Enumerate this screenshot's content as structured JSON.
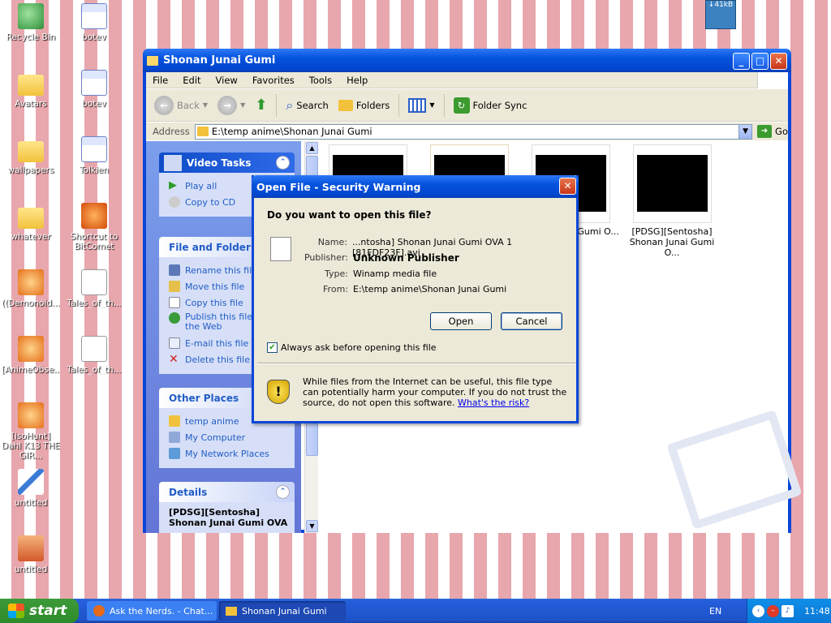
{
  "desktop": {
    "icons": [
      {
        "label": "Recycle Bin",
        "icon": "recycle-bin-icon"
      },
      {
        "label": "botev",
        "icon": "word-document-icon"
      },
      {
        "label": "Avatars",
        "icon": "folder-icon"
      },
      {
        "label": "botev",
        "icon": "word-document-icon"
      },
      {
        "label": "wallpapers",
        "icon": "folder-icon"
      },
      {
        "label": "Tolkien",
        "icon": "word-document-icon"
      },
      {
        "label": "whatever",
        "icon": "folder-icon"
      },
      {
        "label": "Shortcut to BitComet",
        "icon": "bitcomet-icon"
      },
      {
        "label": "((Demonoid....",
        "icon": "winamp-file-icon"
      },
      {
        "label": "Tales_of_th...",
        "icon": "script-file-icon"
      },
      {
        "label": "[AnimeObse...",
        "icon": "winamp-file-icon"
      },
      {
        "label": "Tales_of_th...",
        "icon": "script-file-icon"
      },
      {
        "label": "[isoHunt] Dahl K13 THE GIR...",
        "icon": "winamp-file-icon"
      },
      {
        "label": "untitled",
        "icon": "paint-file-icon"
      },
      {
        "label": "untitled",
        "icon": "archive-file-icon"
      }
    ],
    "net_meter": "↓41kB"
  },
  "explorer": {
    "title": "Shonan Junai Gumi",
    "menu": [
      "File",
      "Edit",
      "View",
      "Favorites",
      "Tools",
      "Help"
    ],
    "toolbar": {
      "back": "Back",
      "search": "Search",
      "folders": "Folders",
      "folder_sync": "Folder Sync"
    },
    "address_label": "Address",
    "address_value": "E:\\temp anime\\Shonan Junai Gumi",
    "go_label": "Go",
    "video_tasks": {
      "title": "Video Tasks",
      "items": [
        "Play all",
        "Copy to CD"
      ]
    },
    "file_folder_tasks": {
      "title": "File and Folder Tasks",
      "items": [
        "Rename this file",
        "Move this file",
        "Copy this file",
        "Publish this file to the Web",
        "E-mail this file",
        "Delete this file"
      ]
    },
    "other_places": {
      "title": "Other Places",
      "items": [
        "temp anime",
        "My Computer",
        "My Network Places"
      ]
    },
    "details": {
      "title": "Details",
      "text": "[PDSG][Sentosha] Shonan Junai Gumi OVA"
    },
    "files": [
      {
        "caption": ""
      },
      {
        "caption": ""
      },
      {
        "caption": "...ntosha] ...Gumi O..."
      },
      {
        "caption": "[PDSG][Sentosha] Shonan Junai Gumi O..."
      }
    ]
  },
  "dialog": {
    "title": "Open File - Security Warning",
    "question": "Do you want to open this file?",
    "name_label": "Name:",
    "name_value": "...ntosha] Shonan Junai Gumi OVA 1 [81FDF23F].avi",
    "publisher_label": "Publisher:",
    "publisher_value": "Unknown Publisher",
    "type_label": "Type:",
    "type_value": "Winamp media file",
    "from_label": "From:",
    "from_value": "E:\\temp anime\\Shonan Junai Gumi",
    "open_button": "Open",
    "cancel_button": "Cancel",
    "checkbox_label": "Always ask before opening this file",
    "checkbox_checked": true,
    "warning_text": "While files from the Internet can be useful, this file type can potentially harm your computer. If you do not trust the source, do not open this software.",
    "risk_link": "What's the risk?"
  },
  "taskbar": {
    "start_label": "start",
    "tasks": [
      "Ask the Nerds. - Chat...",
      "Shonan Junai Gumi"
    ],
    "language": "EN",
    "clock": "11:48"
  }
}
